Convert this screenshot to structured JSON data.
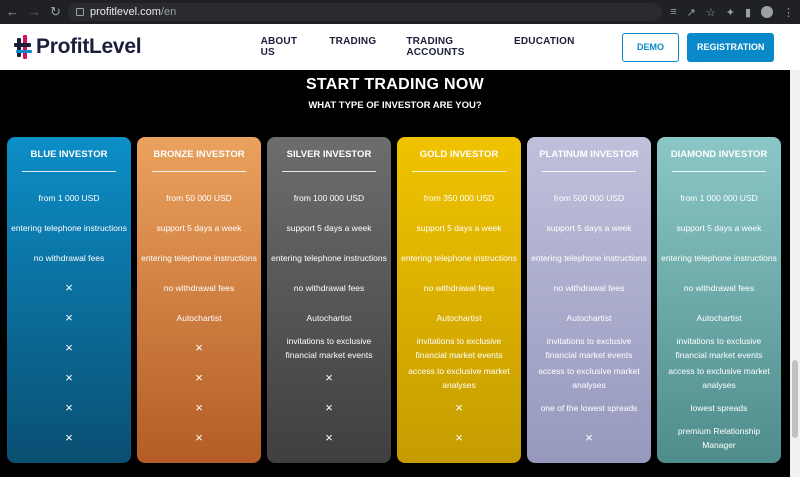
{
  "browser": {
    "url_host": "profitlevel.com",
    "url_path": "/en",
    "back_icon": "arrow-left",
    "forward_icon": "arrow-right",
    "reload_icon": "reload"
  },
  "header": {
    "logo_text": "ProfitLevel",
    "nav": [
      "ABOUT US",
      "TRADING",
      "TRADING ACCOUNTS",
      "EDUCATION"
    ],
    "demo_label": "DEMO",
    "register_label": "REGISTRATION",
    "accent": "#0a89c9"
  },
  "section": {
    "title": "START TRADING NOW",
    "subtitle": "WHAT TYPE OF INVESTOR ARE YOU?"
  },
  "cards": [
    {
      "name": "BLUE INVESTOR",
      "colors": [
        "#0c8ec7",
        "#0a4f72"
      ],
      "features": [
        "from 1 000 USD",
        "entering telephone instructions",
        "no withdrawal fees",
        "",
        "",
        "",
        "",
        "",
        ""
      ]
    },
    {
      "name": "BRONZE INVESTOR",
      "colors": [
        "#eba25e",
        "#b45c26"
      ],
      "features": [
        "from 50 000 USD",
        "support 5 days a week",
        "entering telephone instructions",
        "no withdrawal fees",
        "Autochartist",
        "",
        "",
        "",
        ""
      ]
    },
    {
      "name": "SILVER INVESTOR",
      "colors": [
        "#6d6d6d",
        "#3f3f3f"
      ],
      "features": [
        "from 100 000 USD",
        "support 5 days a week",
        "entering telephone instructions",
        "no withdrawal fees",
        "Autochartist",
        "invitations to exclusive financial market events",
        "",
        "",
        ""
      ]
    },
    {
      "name": "GOLD INVESTOR",
      "colors": [
        "#f0c300",
        "#c59c00"
      ],
      "features": [
        "from 350 000 USD",
        "support 5 days a week",
        "entering telephone instructions",
        "no withdrawal fees",
        "Autochartist",
        "invitations to exclusive financial market events",
        "access to exclusive market analyses",
        "",
        ""
      ]
    },
    {
      "name": "PLATINUM INVESTOR",
      "colors": [
        "#bfc0db",
        "#9698bd"
      ],
      "features": [
        "from 500 000 USD",
        "support 5 days a week",
        "entering telephone instructions",
        "no withdrawal fees",
        "Autochartist",
        "invitations to exclusive financial market events",
        "access to exclusive market analyses",
        "one of the lowest spreads",
        ""
      ]
    },
    {
      "name": "DIAMOND INVESTOR",
      "colors": [
        "#8ac7c6",
        "#4f8c8c"
      ],
      "features": [
        "from 1 000 000 USD",
        "support 5 days a week",
        "entering telephone instructions",
        "no withdrawal fees",
        "Autochartist",
        "invitations to exclusive financial market events",
        "access to exclusive market analyses",
        "lowest spreads",
        "premium Relationship Manager"
      ]
    }
  ],
  "unavailable_icon": "×"
}
